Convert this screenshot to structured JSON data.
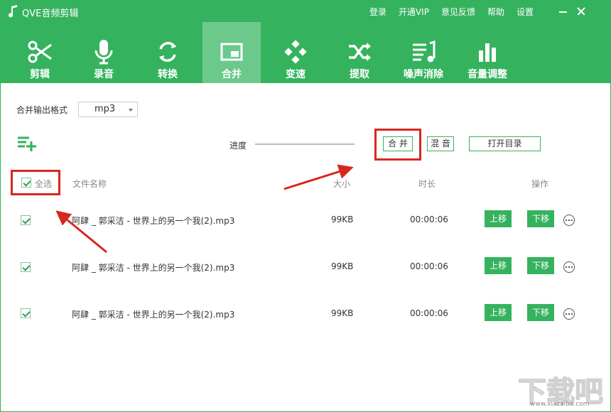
{
  "app": {
    "title": "QVE音频剪辑"
  },
  "top_links": [
    "登录",
    "开通VIP",
    "意见反馈",
    "帮助",
    "设置"
  ],
  "toolbar": {
    "items": [
      {
        "label": "剪辑",
        "icon": "scissors-icon"
      },
      {
        "label": "录音",
        "icon": "microphone-icon"
      },
      {
        "label": "转换",
        "icon": "refresh-icon"
      },
      {
        "label": "合并",
        "icon": "merge-icon",
        "active": true
      },
      {
        "label": "变速",
        "icon": "gamepad-icon"
      },
      {
        "label": "提取",
        "icon": "shuffle-icon"
      },
      {
        "label": "噪声消除",
        "icon": "noise-icon"
      },
      {
        "label": "音量调整",
        "icon": "volume-bars-icon"
      }
    ]
  },
  "format": {
    "label": "合并输出格式",
    "value": "mp3"
  },
  "progress": {
    "label": "进度",
    "value": 0
  },
  "actions": {
    "merge": "合 并",
    "mix": "混 音",
    "open_dir": "打开目录"
  },
  "table": {
    "select_all": "全选",
    "columns": {
      "name": "文件名称",
      "size": "大小",
      "duration": "时长",
      "ops": "操作"
    },
    "up_label": "上移",
    "down_label": "下移",
    "rows": [
      {
        "name": "阿肆 _ 郭采洁 - 世界上的另一个我(2).mp3",
        "size": "99KB",
        "duration": "00:00:06"
      },
      {
        "name": "阿肆 _ 郭采洁 - 世界上的另一个我(2).mp3",
        "size": "99KB",
        "duration": "00:00:06"
      },
      {
        "name": "阿肆 _ 郭采洁 - 世界上的另一个我(2).mp3",
        "size": "99KB",
        "duration": "00:00:06"
      }
    ]
  },
  "watermark": {
    "text": "下载吧",
    "url": "www.xiazaiba.com"
  },
  "colors": {
    "brand_green": "#35b25e",
    "active_tab": "#6bc98c",
    "highlight_red": "#d6281f"
  }
}
